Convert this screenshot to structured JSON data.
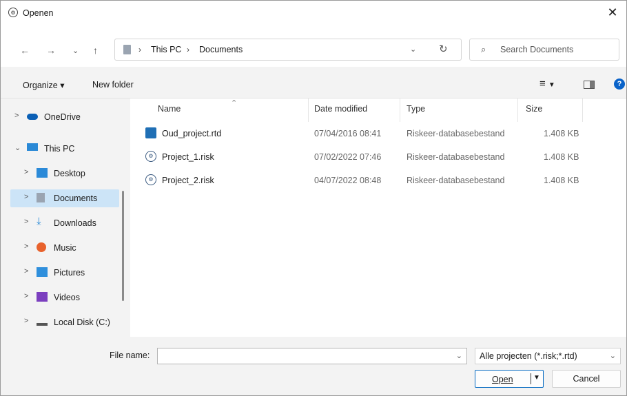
{
  "window": {
    "title": "Openen"
  },
  "nav": {
    "back": "←",
    "forward": "→",
    "recent": "⌄",
    "up": "↑",
    "breadcrumb": [
      "This PC",
      "Documents"
    ],
    "search_placeholder": "Search Documents"
  },
  "toolbar": {
    "organize": "Organize ▾",
    "new_folder": "New folder",
    "help": "?"
  },
  "sidebar": {
    "items": [
      {
        "label": "OneDrive",
        "icon": "cloud-icon",
        "expand": ">"
      },
      {
        "label": "This PC",
        "icon": "computer-icon",
        "expand": "⌄"
      },
      {
        "label": "Desktop",
        "icon": "desktop-folder-icon",
        "expand": ">"
      },
      {
        "label": "Documents",
        "icon": "documents-folder-icon",
        "expand": ">",
        "selected": true
      },
      {
        "label": "Downloads",
        "icon": "download-icon",
        "expand": ">"
      },
      {
        "label": "Music",
        "icon": "music-icon",
        "expand": ">"
      },
      {
        "label": "Pictures",
        "icon": "pictures-icon",
        "expand": ">"
      },
      {
        "label": "Videos",
        "icon": "videos-icon",
        "expand": ">"
      },
      {
        "label": "Local Disk (C:)",
        "icon": "disk-icon",
        "expand": ">"
      }
    ]
  },
  "columns": {
    "name": "Name",
    "date": "Date modified",
    "type": "Type",
    "size": "Size"
  },
  "files": [
    {
      "name": "Oud_project.rtd",
      "date": "07/04/2016 08:41",
      "type": "Riskeer-databasebestand",
      "size": "1.408 KB",
      "icon": "rtd-file-icon"
    },
    {
      "name": "Project_1.risk",
      "date": "07/02/2022 07:46",
      "type": "Riskeer-databasebestand",
      "size": "1.408 KB",
      "icon": "risk-file-icon"
    },
    {
      "name": "Project_2.risk",
      "date": "04/07/2022 08:48",
      "type": "Riskeer-databasebestand",
      "size": "1.408 KB",
      "icon": "risk-file-icon"
    }
  ],
  "footer": {
    "file_name_label": "File name:",
    "file_name_value": "",
    "filter": "Alle projecten (*.risk;*.rtd)",
    "open": "Open",
    "cancel": "Cancel"
  },
  "colors": {
    "accent": "#0067c0",
    "selection": "#cce4f7"
  }
}
